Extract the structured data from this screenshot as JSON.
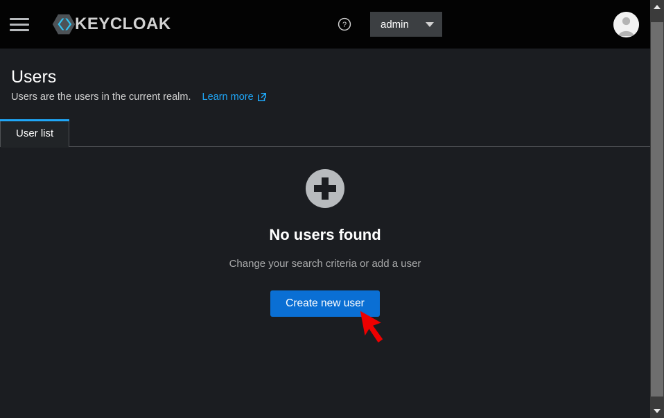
{
  "masthead": {
    "menu_icon": "hamburger-icon",
    "brand_name": "KEYCLOAK",
    "brand_logo_icon": "keycloak-logo-icon",
    "help_icon": "help-circle-icon",
    "realm_label": "admin",
    "realm_caret_icon": "caret-down-icon",
    "avatar_icon": "user-avatar-icon",
    "background_color": "#030303"
  },
  "page": {
    "title": "Users",
    "subtitle": "Users are the users in the current realm.",
    "learn_more_label": "Learn more",
    "learn_more_icon": "external-link-icon",
    "link_color": "#1fa7f8",
    "background_color": "#1b1d21"
  },
  "tabs": {
    "items": [
      {
        "label": "User list",
        "active": true
      }
    ],
    "active_indicator_color": "#1fa7f8"
  },
  "empty_state": {
    "icon": "plus-circle-icon",
    "icon_color": "#b8bbbe",
    "title": "No users found",
    "body": "Change your search criteria or add a user",
    "primary_button_label": "Create new user",
    "primary_button_color": "#0a6fd4"
  },
  "annotation": {
    "cursor_icon": "red-arrow-pointer",
    "color": "#ee0000"
  },
  "scrollbar": {
    "up_icon": "scroll-up-arrow-icon",
    "down_icon": "scroll-down-arrow-icon",
    "track_color": "#3b3b3b",
    "thumb_color": "#6e6e6e"
  }
}
